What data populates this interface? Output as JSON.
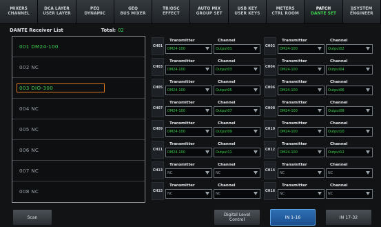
{
  "tabs": [
    {
      "main": "MIXERS",
      "sub": "CHANNEL"
    },
    {
      "main": "DCA LAYER",
      "sub": "USER LAYER"
    },
    {
      "main": "PEQ",
      "sub": "DYNAMIC"
    },
    {
      "main": "GEQ",
      "sub": "BUS MIXER"
    },
    {
      "main": "TB/OSC",
      "sub": "EFFECT"
    },
    {
      "main": "AUTO MIX",
      "sub": "GROUP SET"
    },
    {
      "main": "USB KEY",
      "sub": "USER KEYS"
    },
    {
      "main": "METERS",
      "sub": "CTRL ROOM"
    },
    {
      "main": "PATCH",
      "sub": "DANTE SET"
    },
    {
      "main": "SYSTEM",
      "sub": "ENGINEER"
    }
  ],
  "list": {
    "title": "DANTE Receiver List",
    "total_label": "Total:",
    "total_value": "02",
    "receivers": [
      "001 DM24-100",
      "002 NC",
      "003 DIO-300",
      "004 NC",
      "005 NC",
      "006 NC",
      "007 NC",
      "008 NC"
    ]
  },
  "labels": {
    "transmitter": "Transmitter",
    "channel": "Channel"
  },
  "patch": [
    {
      "ch": "CH01",
      "tx": "DM24-100",
      "chv": "Output01"
    },
    {
      "ch": "CH02",
      "tx": "DM24-100",
      "chv": "Output02"
    },
    {
      "ch": "CH03",
      "tx": "DM24-100",
      "chv": "Output03"
    },
    {
      "ch": "CH04",
      "tx": "DM24-100",
      "chv": "Output04"
    },
    {
      "ch": "CH05",
      "tx": "DM24-100",
      "chv": "Output05"
    },
    {
      "ch": "CH06",
      "tx": "DM24-100",
      "chv": "Output06"
    },
    {
      "ch": "CH07",
      "tx": "DM24-100",
      "chv": "Output07"
    },
    {
      "ch": "CH08",
      "tx": "DM24-100",
      "chv": "Output08"
    },
    {
      "ch": "CH09",
      "tx": "DM24-100",
      "chv": "Output09"
    },
    {
      "ch": "CH10",
      "tx": "DM24-100",
      "chv": "Output10"
    },
    {
      "ch": "CH11",
      "tx": "DM24-100",
      "chv": "Output11"
    },
    {
      "ch": "CH12",
      "tx": "DM24-100",
      "chv": "Output12"
    },
    {
      "ch": "CH13",
      "tx": "NC",
      "chv": "NC"
    },
    {
      "ch": "CH14",
      "tx": "NC",
      "chv": "NC"
    },
    {
      "ch": "CH15",
      "tx": "NC",
      "chv": "NC"
    },
    {
      "ch": "CH16",
      "tx": "NC",
      "chv": "NC"
    }
  ],
  "buttons": {
    "scan": "Scan",
    "digital_level_1": "Digital Level",
    "digital_level_2": "Control",
    "in_1_16": "IN 1-16",
    "in_17_32": "IN 17-32"
  },
  "colors": {
    "accent_green": "#3fd24f",
    "selected_orange": "#e07a1a",
    "active_blue": "#2e6fb3"
  }
}
